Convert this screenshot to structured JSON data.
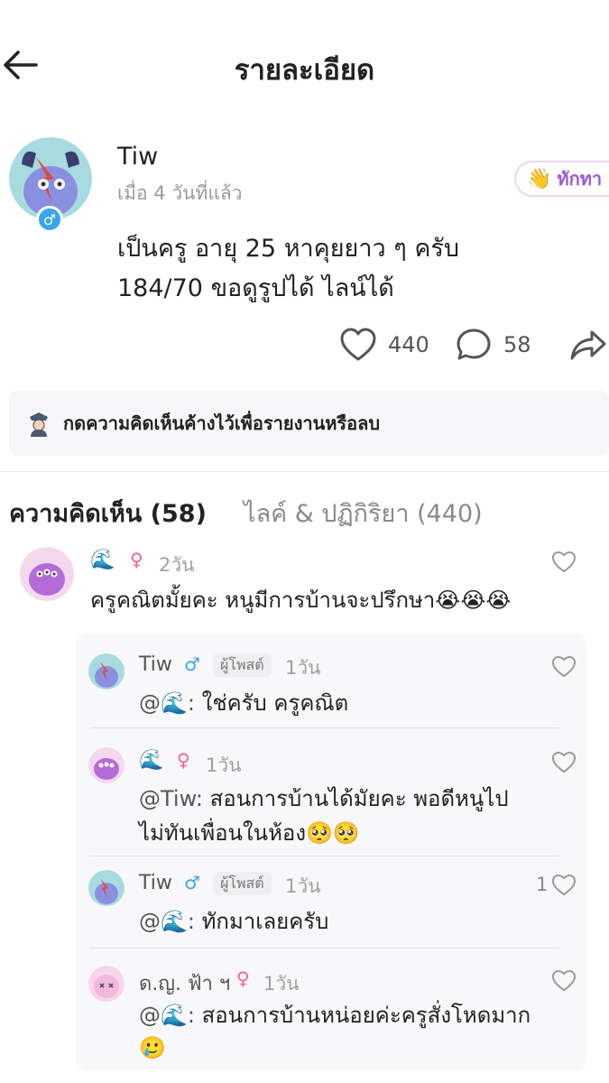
{
  "header": {
    "title": "รายละเอียด"
  },
  "post": {
    "author": "Tiw",
    "time": "เมื่อ 4 วันที่แล้ว",
    "gender_symbol": "♂",
    "greet_emoji": "👋",
    "greet_label": "ทักทา",
    "body_line1": "เป็นครู อายุ 25 หาคุยยาว ๆ ครับ",
    "body_line2": "184/70 ขอดูรูปได้ ไลน์ได้",
    "likes": "440",
    "comments": "58"
  },
  "notice": {
    "text": "กดความคิดเห็นค้างไว้เพื่อรายงานหรือลบ"
  },
  "tabs": {
    "comments": "ความคิดเห็น (58)",
    "likes": "ไลค์ & ปฏิกิริยา (440)"
  },
  "comments": [
    {
      "name": "🌊",
      "gender": "♀",
      "time": "2วัน",
      "text": "ครูคณิตมั้ยคะ หนูมีการบ้านจะปรึกษา😭😭😭"
    }
  ],
  "replies": [
    {
      "name": "Tiw",
      "gender": "♂",
      "badge": "ผู้โพสต์",
      "time": "1วัน",
      "mention": "@🌊:",
      "text": " ใช่ครับ ครูคณิต"
    },
    {
      "name": "🌊",
      "gender": "♀",
      "time": "1วัน",
      "mention": "@Tiw:",
      "text": " สอนการบ้านได้มัยคะ พอดีหนูไป",
      "text2": "ไม่ทันเพื่อนในห้อง🥺🥺"
    },
    {
      "name": "Tiw",
      "gender": "♂",
      "badge": "ผู้โพสต์",
      "time": "1วัน",
      "mention": "@🌊:",
      "text": " ทักมาเลยครับ",
      "likes": "1"
    },
    {
      "name": "ด.ญ. ฟ้า ฯ",
      "gender": "♀",
      "time": "1วัน",
      "mention": "@🌊:",
      "text": " สอนการบ้านหน่อยค่ะครูสั่งโหดมาก",
      "text2": "🥲"
    }
  ],
  "colors": {
    "accent_purple": "#9b59d6",
    "male_blue": "#3aa4e8",
    "female_pink": "#f06292"
  },
  "icons": [
    "back-arrow-icon",
    "heart-icon",
    "comment-icon",
    "share-icon",
    "police-icon"
  ]
}
